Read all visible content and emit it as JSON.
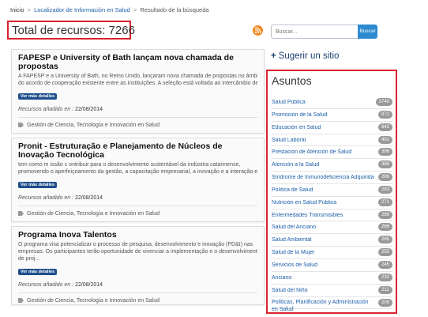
{
  "breadcrumb": {
    "home": "Inicio",
    "separator": ">",
    "section": "Localizador de Información en Salud",
    "current": "Resultado de la búsqueda"
  },
  "total": "Total de recursos: 7266",
  "icons": {
    "rss": "rss-icon",
    "plus": "plus-icon",
    "tag": "tag-icon"
  },
  "colors": {
    "accent_red": "#d9232e",
    "link_blue": "#1b5ea8",
    "button_blue": "#1f4f8c",
    "search_blue": "#2e8ad0",
    "rss_orange": "#f08a24",
    "badge_gray": "#999999"
  },
  "search": {
    "placeholder": "Buscar...",
    "button_label": "Buscar"
  },
  "suggest": {
    "plus": "+",
    "label": "Sugerir un sitio"
  },
  "results": [
    {
      "title": "FAPESP e University of Bath lançam nova chamada de propostas",
      "summary_lines": [
        "A FAPESP e a University of Bath, no Reino Unido, lançaram nova chamada de propostas no âmbito",
        "do acordo de cooperação existente entre as instituições. A seleção está voltada ao intercâmbio de pesquisa..."
      ],
      "button": "Ver más detalles",
      "date_label": "Recursos añadido en :",
      "date": "22/08/2014",
      "tag": "Gestión de Ciencia, Tecnología e Innovación en Salud"
    },
    {
      "title": "Pronit - Estruturação e Planejamento de Núcleos de Inovação Tecnológica",
      "summary_lines": [
        "tem como m issão c ontribuir para o desenvolvimento sustentável da indústria catarinense,",
        "promovendo o aperfeiçoamento da gestão, a capacitação empresarial, a inovação e a interação en..."
      ],
      "button": "Ver más detalles",
      "date_label": "Recursos añadido en :",
      "date": "22/08/2014",
      "tag": "Gestión de Ciencia, Tecnología e Innovación en Salud"
    },
    {
      "title": "Programa Inova Talentos",
      "summary_lines": [
        "O programa visa potencializar o processo de pesquisa, desenvolvimento e inovação (PD&I) nas",
        "empresas. Os participantes terão oportunidade de vivenciar a implementação e o desenvolvimento",
        "de proj..."
      ],
      "button": "Ver más detalles",
      "date_label": "Recursos añadido en :",
      "date": "22/08/2014",
      "tag": "Gestión de Ciencia, Tecnología e Innovación en Salud"
    }
  ],
  "asuntos": {
    "title": "Asuntos",
    "items": [
      {
        "label": "Salud Pública",
        "count": "3749"
      },
      {
        "label": "Promoción de la Salud",
        "count": "872"
      },
      {
        "label": "Educación en Salud",
        "count": "642"
      },
      {
        "label": "Salud Laboral",
        "count": "401"
      },
      {
        "label": "Prestación de Atención de Salud",
        "count": "396"
      },
      {
        "label": "Atención a la Salud",
        "count": "388"
      },
      {
        "label": "Síndrome de Inmunodeficiencia Adquirida",
        "count": "286"
      },
      {
        "label": "Política de Salud",
        "count": "283"
      },
      {
        "label": "Nutrición en Salud Pública",
        "count": "271"
      },
      {
        "label": "Enfermedades Transmisibles",
        "count": "269"
      },
      {
        "label": "Salud del Anciano",
        "count": "266"
      },
      {
        "label": "Salud Ambiental",
        "count": "265"
      },
      {
        "label": "Salud de la Mujer",
        "count": "255"
      },
      {
        "label": "Servicios de Salud",
        "count": "245"
      },
      {
        "label": "Anciano",
        "count": "232"
      },
      {
        "label": "Salud del Niño",
        "count": "211"
      },
      {
        "label": "Políticas, Planificación y Administración en Salud",
        "count": "205"
      }
    ]
  }
}
